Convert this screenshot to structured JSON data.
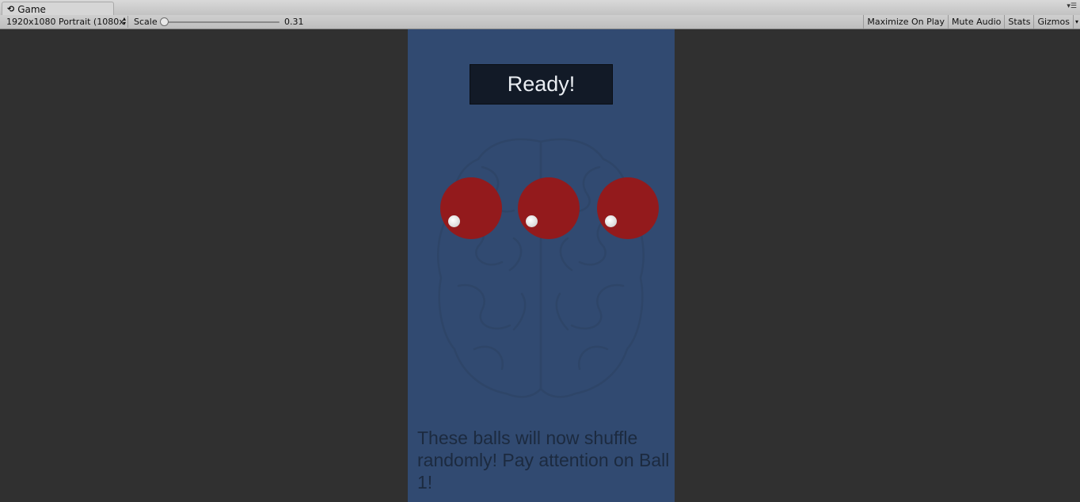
{
  "window": {
    "tab_title": "Game",
    "tab_icon": "unity-icon"
  },
  "toolbar": {
    "resolution": "1920x1080 Portrait (1080x",
    "scale_label": "Scale",
    "scale_value": "0.31",
    "buttons": [
      "Maximize On Play",
      "Mute Audio",
      "Stats",
      "Gizmos"
    ]
  },
  "game": {
    "ready_label": "Ready!",
    "balls": [
      {
        "name": "ball-1"
      },
      {
        "name": "ball-2"
      },
      {
        "name": "ball-3"
      }
    ],
    "instruction": "These balls will now shuffle randomly! Pay attention on Ball 1!",
    "colors": {
      "background": "#314a71",
      "ball": "#931a1c",
      "button": "#121a27"
    }
  }
}
